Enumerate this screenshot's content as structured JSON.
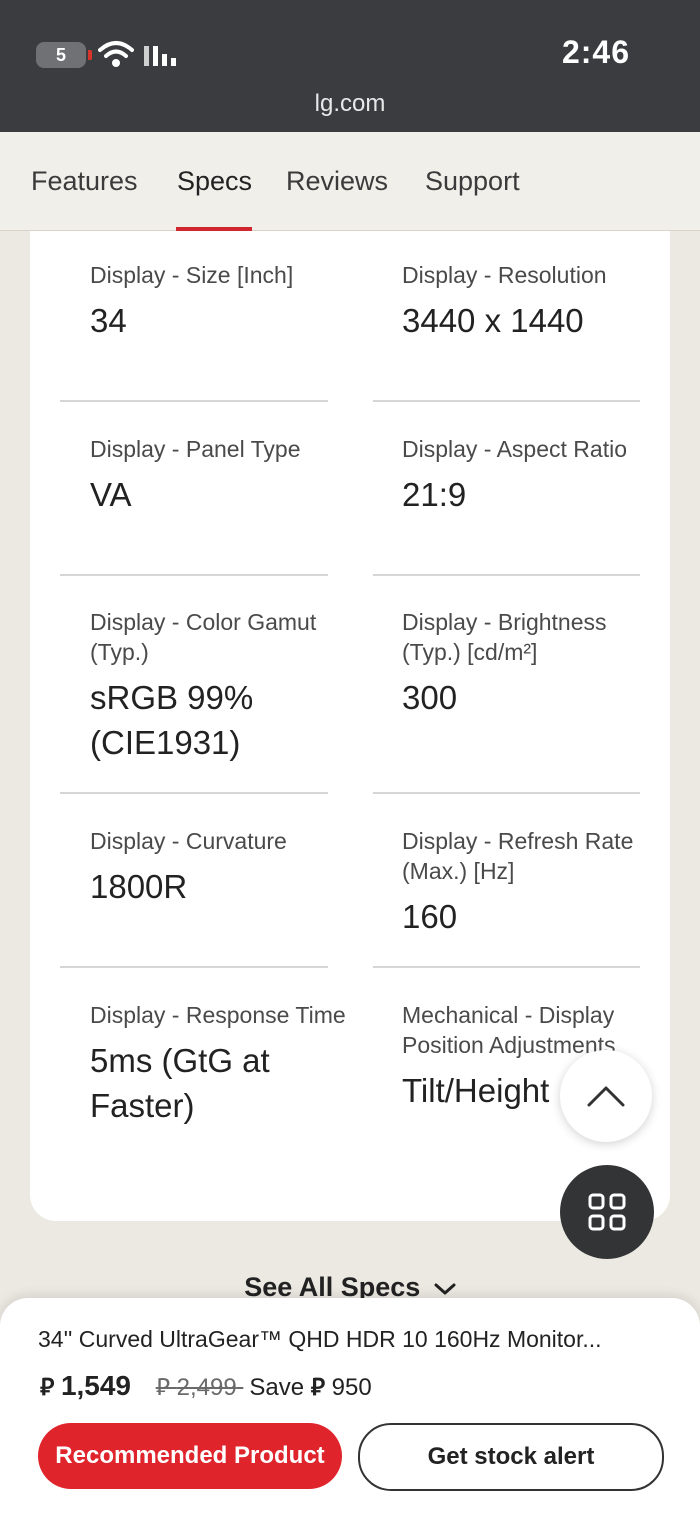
{
  "status_bar": {
    "battery": "5",
    "time": "2:46",
    "url": "lg.com"
  },
  "tabs": [
    {
      "label": "Features"
    },
    {
      "label": "Specs",
      "active": true
    },
    {
      "label": "Reviews"
    },
    {
      "label": "Support"
    }
  ],
  "specs": [
    {
      "label": "Display - Size [Inch]",
      "value": "34"
    },
    {
      "label": "Display - Resolution",
      "value": "3440 x 1440"
    },
    {
      "label": "Display - Panel Type",
      "value": "VA"
    },
    {
      "label": "Display - Aspect Ratio",
      "value": "21:9"
    },
    {
      "label": "Display - Color Gamut (Typ.)",
      "value": "sRGB 99% (CIE1931)"
    },
    {
      "label": "Display - Brightness (Typ.) [cd/m²]",
      "value": "300"
    },
    {
      "label": "Display - Curvature",
      "value": "1800R"
    },
    {
      "label": "Display - Refresh Rate (Max.) [Hz]",
      "value": "160"
    },
    {
      "label": "Display - Response Time",
      "value": "5ms (GtG at Faster)"
    },
    {
      "label": "Mechanical - Display Position Adjustments",
      "value": "Tilt/Height"
    }
  ],
  "see_all_specs": "See All Specs",
  "product": {
    "title": "34'' Curved UltraGear™ QHD HDR 10 160Hz Monitor...",
    "currency_symbol": "⃁",
    "price": "1,549",
    "old_price": "2,499",
    "save_label": "Save",
    "save_amount": "950",
    "primary_button": "Recommended Product",
    "secondary_button": "Get stock alert"
  },
  "colors": {
    "accent": "#d0262f",
    "primary_button": "#e0242c",
    "status_bar": "#3a3c3f"
  }
}
